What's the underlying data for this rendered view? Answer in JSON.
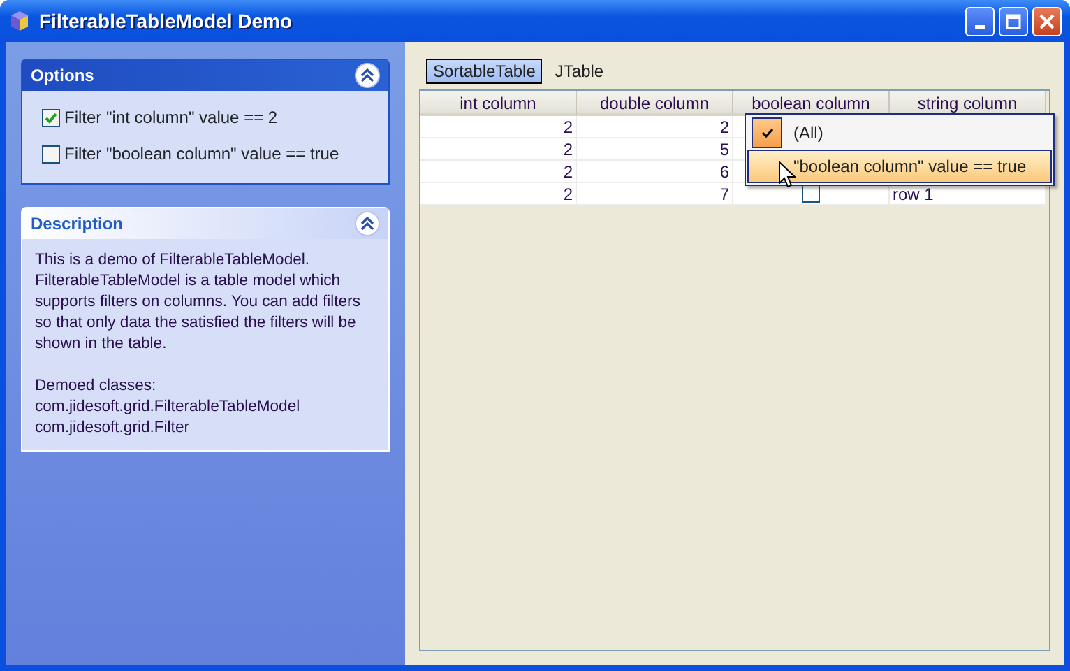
{
  "window": {
    "title": "FilterableTableModel Demo"
  },
  "options": {
    "title": "Options",
    "expanded": true,
    "items": [
      {
        "label": "Filter \"int column\" value == 2",
        "checked": true
      },
      {
        "label": "Filter \"boolean column\" value == true",
        "checked": false
      }
    ]
  },
  "description": {
    "title": "Description",
    "expanded": true,
    "paragraphs": [
      "This is a demo of FilterableTableModel. FilterableTableModel is a table model which supports filters on columns. You can add filters so that only data the satisfied the filters will be shown in the table.",
      "Demoed classes:\ncom.jidesoft.grid.FilterableTableModel\ncom.jidesoft.grid.Filter"
    ]
  },
  "tabs": [
    {
      "label": "SortableTable",
      "selected": true
    },
    {
      "label": "JTable",
      "selected": false
    }
  ],
  "table": {
    "columns": [
      "int column",
      "double column",
      "boolean column",
      "string column"
    ],
    "rows": [
      {
        "int": "2",
        "double": "2"
      },
      {
        "int": "2",
        "double": "5"
      },
      {
        "int": "2",
        "double": "6"
      },
      {
        "int": "2",
        "double": "7",
        "boolean": {
          "checked": false
        },
        "string": "row 1"
      }
    ]
  },
  "filter_menu": {
    "items": [
      {
        "label": "(All)",
        "selected": true,
        "hovered": false
      },
      {
        "label": "\"boolean column\" value == true",
        "selected": false,
        "hovered": true
      }
    ]
  }
}
